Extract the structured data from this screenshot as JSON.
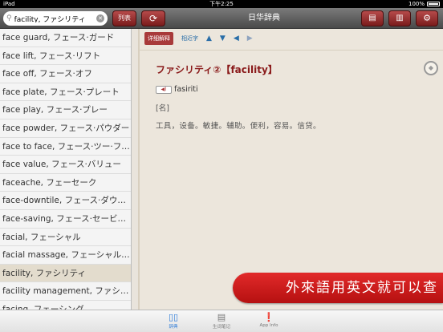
{
  "status_bar": {
    "device": "iPad",
    "time": "下午2:25",
    "battery": "100%"
  },
  "toolbar": {
    "search_value": "facility, ファシリティ",
    "search_icon": "search-icon",
    "list_button": "列表",
    "refresh_icon": "refresh-icon",
    "title": "日华辞典",
    "icon_buttons": [
      "notes-icon",
      "book-icon",
      "gear-icon"
    ]
  },
  "word_list": [
    "face guard, フェース·ガード",
    "face lift, フェース·リフト",
    "face off, フェース·オフ",
    "face plate, フェース·プレート",
    "face play, フェース·プレー",
    "face powder, フェース·パウダー",
    "face to face, フェース·ツー·フ…",
    "face value, フェース·バリュー",
    "faceache, フェーセーク",
    "face-downtile, フェース·ダウ…",
    "face-saving, フェース·セービ…",
    "facial, フェーシャル",
    "facial massage, フェーシャル·…",
    "facility, ファシリティ",
    "facility management, ファシリ…",
    "facing, フェーシング"
  ],
  "selected_index": 13,
  "content": {
    "tab_detail": "详细解释",
    "tab_similar": "相近字",
    "arrows": [
      "▲",
      "▼",
      "◀",
      "▶"
    ],
    "headword": "ファシリティ②【facility】",
    "reading": "fasiriti",
    "pos": "[名]",
    "definition": "工具，设备。敏捷。辅助。便利，容易。信贷。"
  },
  "promo": "外來語用英文就可以查",
  "tabbar": {
    "items": [
      {
        "label": "辞典",
        "icon": "book-icon"
      },
      {
        "label": "生词笔记",
        "icon": "notebook-icon"
      },
      {
        "label": "App Info",
        "icon": "info-icon"
      }
    ]
  }
}
